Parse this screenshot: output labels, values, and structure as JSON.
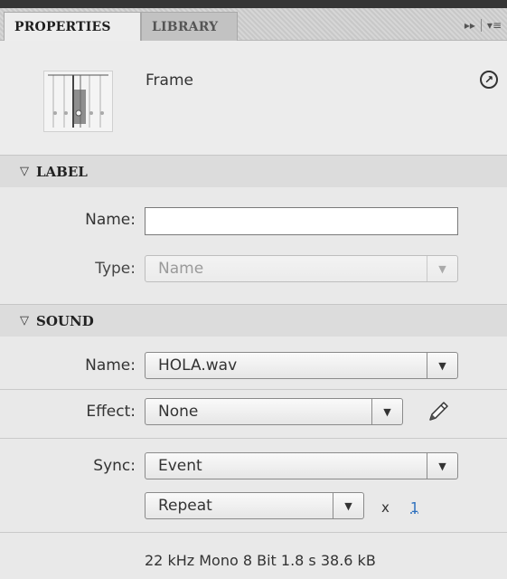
{
  "tabs": [
    {
      "label": "PROPERTIES"
    },
    {
      "label": "LIBRARY"
    }
  ],
  "icons": {
    "expand": "double-chevron-right-icon",
    "menu": "panel-menu-icon",
    "goto": "arrow-up-right-circle-icon",
    "pencil": "pencil-icon"
  },
  "header": {
    "title": "Frame"
  },
  "label_section": {
    "title": "LABEL",
    "name_label": "Name:",
    "name_value": "",
    "type_label": "Type:",
    "type_value": "Name"
  },
  "sound_section": {
    "title": "SOUND",
    "name_label": "Name:",
    "name_value": "HOLA.wav",
    "effect_label": "Effect:",
    "effect_value": "None",
    "sync_label": "Sync:",
    "sync_value": "Event",
    "repeat_value": "Repeat",
    "repeat_x": "x",
    "repeat_count": "1",
    "info": "22 kHz Mono 8 Bit 1.8 s 38.6 kB"
  }
}
